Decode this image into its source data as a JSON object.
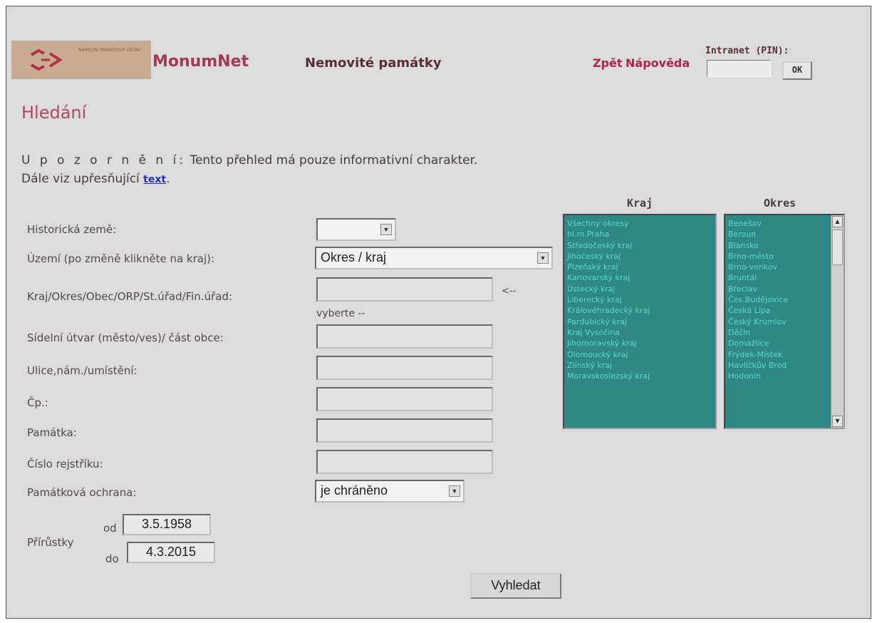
{
  "header": {
    "logo_text": "NÁRODNÍ PAMÁTKOVÝ ÚSTAV",
    "brand": "MonumNet",
    "section": "Nemovité památky",
    "links": {
      "back": "Zpět",
      "help": "Nápověda"
    },
    "intranet_label": "Intranet (PIN):",
    "ok_label": "OK"
  },
  "page": {
    "heading": "Hledání",
    "notice_spaced": "U p o z o r n ě n í:",
    "notice_text": " Tento přehled má pouze informativní charakter.",
    "notice_line2": "Dále viz upřesňující ",
    "notice_link": "text",
    "notice_end": "."
  },
  "form": {
    "historicka_zeme": {
      "label": "Historická země:",
      "value": ""
    },
    "uzemi": {
      "label": "Území (po změně klikněte na kraj):",
      "value": "Okres / kraj"
    },
    "kraj_okres": {
      "label": "Kraj/Okres/Obec/ORP/St.úřad/Fin.úřad:",
      "hint_arrow": "<--",
      "hint_text": "vyberte --"
    },
    "sidelni_utvar": {
      "label": "Sídelní útvar (město/ves)/ část obce:"
    },
    "ulice": {
      "label": "Ulice,nám./umístění:"
    },
    "cp": {
      "label": "Čp.:"
    },
    "pamatka": {
      "label": "Památka:"
    },
    "cislo_rejstriku": {
      "label": "Číslo rejstříku:"
    },
    "ochrana": {
      "label": "Památková ochrana:",
      "value": "je chráněno"
    },
    "prirustky": {
      "label": "Přírůstky",
      "od_label": "od",
      "od_value": "3.5.1958",
      "do_label": "do",
      "do_value": "4.3.2015"
    },
    "search_label": "Vyhledat"
  },
  "kraj": {
    "title": "Kraj",
    "items": [
      "Všechny okresy",
      "hl.m.Praha",
      "Středočeský kraj",
      "Jihočeský kraj",
      "Plzeňský kraj",
      "Karlovarský kraj",
      "Ústecký kraj",
      "Liberecký kraj",
      "Královéhradecký kraj",
      "Pardubický kraj",
      "Kraj Vysočina",
      "Jihomoravský kraj",
      "Olomoucký kraj",
      "Zlínský kraj",
      "Moravskoslezský kraj"
    ]
  },
  "okres": {
    "title": "Okres",
    "items": [
      "Benešov",
      "Beroun",
      "Blansko",
      "Brno-město",
      "Brno-venkov",
      "Bruntál",
      "Břeclav",
      "Čes.Budějovice",
      "Česká Lípa",
      "Český Krumlov",
      "Děčín",
      "Domažlice",
      "Frýdek-Místek",
      "Havlíčkův Brod",
      "Hodonín"
    ]
  },
  "colors": {
    "accent": "#b0244a",
    "listbox": "#2f8884",
    "background": "#dcdcdc"
  }
}
